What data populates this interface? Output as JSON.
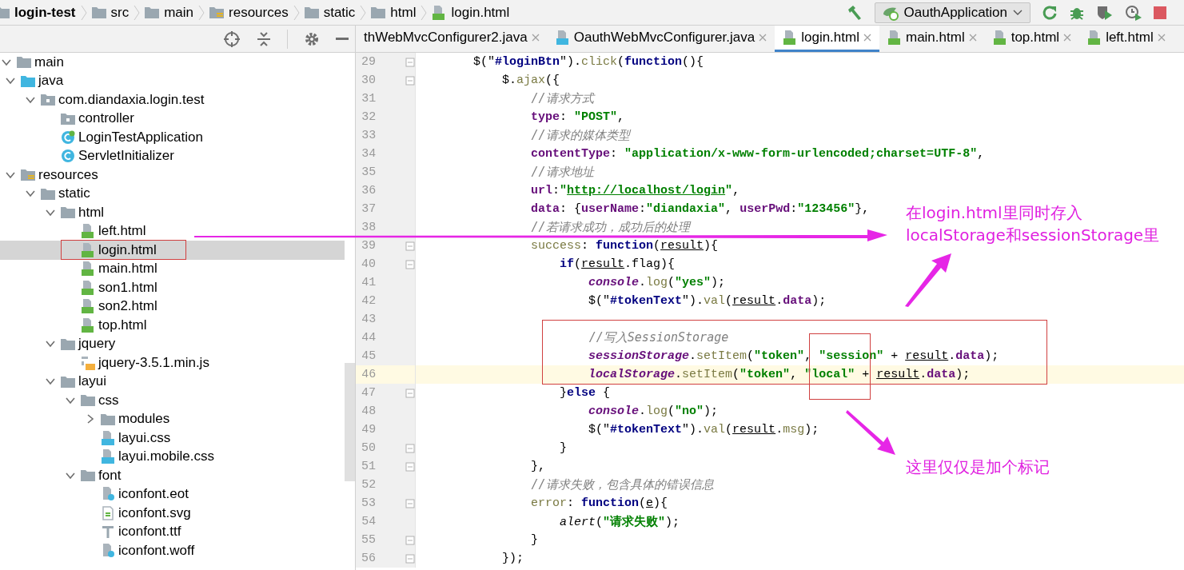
{
  "breadcrumbs": [
    {
      "label": "login-test",
      "kind": "project"
    },
    {
      "label": "src",
      "kind": "folder"
    },
    {
      "label": "main",
      "kind": "folder"
    },
    {
      "label": "resources",
      "kind": "resources"
    },
    {
      "label": "static",
      "kind": "folder"
    },
    {
      "label": "html",
      "kind": "folder"
    },
    {
      "label": "login.html",
      "kind": "html"
    }
  ],
  "run_config": {
    "label": "OauthApplication"
  },
  "tree": [
    {
      "label": "main",
      "kind": "folder",
      "expanded": true,
      "selected": false,
      "children": [
        {
          "label": "java",
          "kind": "source",
          "expanded": true,
          "selected": false,
          "children": [
            {
              "label": "com.diandaxia.login.test",
              "kind": "package",
              "expanded": true,
              "selected": false,
              "children": [
                {
                  "label": "controller",
                  "kind": "package",
                  "selected": false
                },
                {
                  "label": "LoginTestApplication",
                  "kind": "spring-class",
                  "selected": false
                },
                {
                  "label": "ServletInitializer",
                  "kind": "class",
                  "selected": false
                }
              ]
            }
          ]
        },
        {
          "label": "resources",
          "kind": "resources",
          "expanded": true,
          "selected": false,
          "children": [
            {
              "label": "static",
              "kind": "folder",
              "expanded": true,
              "selected": false,
              "children": [
                {
                  "label": "html",
                  "kind": "folder",
                  "expanded": true,
                  "selected": false,
                  "children": [
                    {
                      "label": "left.html",
                      "kind": "html",
                      "selected": false
                    },
                    {
                      "label": "login.html",
                      "kind": "html",
                      "selected": true
                    },
                    {
                      "label": "main.html",
                      "kind": "html",
                      "selected": false
                    },
                    {
                      "label": "son1.html",
                      "kind": "html",
                      "selected": false
                    },
                    {
                      "label": "son2.html",
                      "kind": "html",
                      "selected": false
                    },
                    {
                      "label": "top.html",
                      "kind": "html",
                      "selected": false
                    }
                  ]
                },
                {
                  "label": "jquery",
                  "kind": "folder",
                  "expanded": true,
                  "selected": false,
                  "children": [
                    {
                      "label": "jquery-3.5.1.min.js",
                      "kind": "js",
                      "selected": false
                    }
                  ]
                },
                {
                  "label": "layui",
                  "kind": "folder",
                  "expanded": true,
                  "selected": false,
                  "children": [
                    {
                      "label": "css",
                      "kind": "folder",
                      "expanded": true,
                      "selected": false,
                      "children": [
                        {
                          "label": "modules",
                          "kind": "folder",
                          "expanded": false,
                          "selected": false
                        },
                        {
                          "label": "layui.css",
                          "kind": "css",
                          "selected": false
                        },
                        {
                          "label": "layui.mobile.css",
                          "kind": "css",
                          "selected": false
                        }
                      ]
                    },
                    {
                      "label": "font",
                      "kind": "folder",
                      "expanded": true,
                      "selected": false,
                      "children": [
                        {
                          "label": "iconfont.eot",
                          "kind": "unknown",
                          "selected": false
                        },
                        {
                          "label": "iconfont.svg",
                          "kind": "svg",
                          "selected": false
                        },
                        {
                          "label": "iconfont.ttf",
                          "kind": "font",
                          "selected": false
                        },
                        {
                          "label": "iconfont.woff",
                          "kind": "unknown",
                          "selected": false
                        }
                      ]
                    }
                  ]
                }
              ]
            }
          ]
        }
      ]
    }
  ],
  "tabs": [
    {
      "label": "thWebMvcConfigurer2.java",
      "kind": "cut",
      "selected": false
    },
    {
      "label": "OauthWebMvcConfigurer.java",
      "kind": "java",
      "selected": false
    },
    {
      "label": "login.html",
      "kind": "html",
      "selected": true
    },
    {
      "label": "main.html",
      "kind": "html",
      "selected": false
    },
    {
      "label": "top.html",
      "kind": "html",
      "selected": false
    },
    {
      "label": "left.html",
      "kind": "html",
      "selected": false
    }
  ],
  "code": [
    {
      "number": "29",
      "fold": true,
      "current": false,
      "tokens": [
        {
          "kind": "p",
          "text": "        $(\""
        },
        {
          "kind": "sel",
          "text": "#loginBtn"
        },
        {
          "kind": "p",
          "text": "\")."
        },
        {
          "kind": "m",
          "text": "click"
        },
        {
          "kind": "p",
          "text": "("
        },
        {
          "kind": "kw",
          "text": "function"
        },
        {
          "kind": "p",
          "text": "(){"
        }
      ]
    },
    {
      "number": "30",
      "fold": true,
      "current": false,
      "tokens": [
        {
          "kind": "p",
          "text": "            $."
        },
        {
          "kind": "m",
          "text": "ajax"
        },
        {
          "kind": "p",
          "text": "({"
        }
      ]
    },
    {
      "number": "31",
      "fold": false,
      "current": false,
      "tokens": [
        {
          "kind": "c",
          "text": "                //请求方式"
        }
      ]
    },
    {
      "number": "32",
      "fold": false,
      "current": false,
      "tokens": [
        {
          "kind": "prop",
          "text": "                type"
        },
        {
          "kind": "p",
          "text": ": "
        },
        {
          "kind": "s",
          "text": "\"POST\""
        },
        {
          "kind": "p",
          "text": ","
        }
      ]
    },
    {
      "number": "33",
      "fold": false,
      "current": false,
      "tokens": [
        {
          "kind": "c",
          "text": "                //请求的媒体类型"
        }
      ]
    },
    {
      "number": "34",
      "fold": false,
      "current": false,
      "tokens": [
        {
          "kind": "prop",
          "text": "                contentType"
        },
        {
          "kind": "p",
          "text": ": "
        },
        {
          "kind": "s",
          "text": "\"application/x-www-form-urlencoded;charset=UTF-8\""
        },
        {
          "kind": "p",
          "text": ","
        }
      ]
    },
    {
      "number": "35",
      "fold": false,
      "current": false,
      "tokens": [
        {
          "kind": "c",
          "text": "                //请求地址"
        }
      ]
    },
    {
      "number": "36",
      "fold": false,
      "current": false,
      "tokens": [
        {
          "kind": "prop",
          "text": "                url"
        },
        {
          "kind": "p",
          "text": ":"
        },
        {
          "kind": "s",
          "text": "\""
        },
        {
          "kind": "link",
          "text": "http://localhost/login"
        },
        {
          "kind": "s",
          "text": "\""
        },
        {
          "kind": "p",
          "text": ","
        }
      ]
    },
    {
      "number": "37",
      "fold": false,
      "current": false,
      "tokens": [
        {
          "kind": "prop",
          "text": "                data"
        },
        {
          "kind": "p",
          "text": ": {"
        },
        {
          "kind": "prop",
          "text": "userName"
        },
        {
          "kind": "p",
          "text": ":"
        },
        {
          "kind": "s",
          "text": "\"diandaxia\""
        },
        {
          "kind": "p",
          "text": ", "
        },
        {
          "kind": "prop",
          "text": "userPwd"
        },
        {
          "kind": "p",
          "text": ":"
        },
        {
          "kind": "s",
          "text": "\"123456\""
        },
        {
          "kind": "p",
          "text": "},"
        }
      ]
    },
    {
      "number": "38",
      "fold": false,
      "current": false,
      "tokens": [
        {
          "kind": "c",
          "text": "                //若请求成功，成功后的处理"
        }
      ]
    },
    {
      "number": "39",
      "fold": true,
      "current": false,
      "tokens": [
        {
          "kind": "m",
          "text": "                success"
        },
        {
          "kind": "p",
          "text": ": "
        },
        {
          "kind": "kw",
          "text": "function"
        },
        {
          "kind": "p",
          "text": "("
        },
        {
          "kind": "u",
          "text": "result"
        },
        {
          "kind": "p",
          "text": "){"
        }
      ]
    },
    {
      "number": "40",
      "fold": true,
      "current": false,
      "tokens": [
        {
          "kind": "kw",
          "text": "                    if"
        },
        {
          "kind": "p",
          "text": "("
        },
        {
          "kind": "u",
          "text": "result"
        },
        {
          "kind": "p",
          "text": ".flag){"
        }
      ]
    },
    {
      "number": "41",
      "fold": false,
      "current": false,
      "tokens": [
        {
          "kind": "g",
          "text": "                        console"
        },
        {
          "kind": "p",
          "text": "."
        },
        {
          "kind": "m",
          "text": "log"
        },
        {
          "kind": "p",
          "text": "("
        },
        {
          "kind": "s",
          "text": "\"yes\""
        },
        {
          "kind": "p",
          "text": ");"
        }
      ]
    },
    {
      "number": "42",
      "fold": false,
      "current": false,
      "tokens": [
        {
          "kind": "p",
          "text": "                        $(\""
        },
        {
          "kind": "sel",
          "text": "#tokenText"
        },
        {
          "kind": "p",
          "text": "\")."
        },
        {
          "kind": "m",
          "text": "val"
        },
        {
          "kind": "p",
          "text": "("
        },
        {
          "kind": "u",
          "text": "result"
        },
        {
          "kind": "p",
          "text": "."
        },
        {
          "kind": "prop",
          "text": "data"
        },
        {
          "kind": "p",
          "text": ");"
        }
      ]
    },
    {
      "number": "43",
      "fold": false,
      "current": false
    },
    {
      "number": "44",
      "fold": false,
      "current": false,
      "tokens": [
        {
          "kind": "c",
          "text": "                        //写入SessionStorage"
        }
      ]
    },
    {
      "number": "45",
      "fold": false,
      "current": false,
      "tokens": [
        {
          "kind": "g",
          "text": "                        sessionStorage"
        },
        {
          "kind": "p",
          "text": "."
        },
        {
          "kind": "m",
          "text": "setItem"
        },
        {
          "kind": "p",
          "text": "("
        },
        {
          "kind": "s",
          "text": "\"token\""
        },
        {
          "kind": "p",
          "text": ", "
        },
        {
          "kind": "s",
          "text": "\"session\""
        },
        {
          "kind": "p",
          "text": " + "
        },
        {
          "kind": "u",
          "text": "result"
        },
        {
          "kind": "p",
          "text": "."
        },
        {
          "kind": "prop",
          "text": "data"
        },
        {
          "kind": "p",
          "text": ");"
        }
      ]
    },
    {
      "number": "46",
      "fold": false,
      "current": true,
      "tokens": [
        {
          "kind": "g",
          "text": "                        localStorage"
        },
        {
          "kind": "p",
          "text": "."
        },
        {
          "kind": "m",
          "text": "setItem"
        },
        {
          "kind": "p",
          "text": "("
        },
        {
          "kind": "s",
          "text": "\"token\""
        },
        {
          "kind": "p",
          "text": ", "
        },
        {
          "kind": "s",
          "text": "\"local\""
        },
        {
          "kind": "p",
          "text": " + "
        },
        {
          "kind": "u",
          "text": "result"
        },
        {
          "kind": "p",
          "text": "."
        },
        {
          "kind": "prop",
          "text": "data"
        },
        {
          "kind": "p",
          "text": ");"
        }
      ]
    },
    {
      "number": "47",
      "fold": true,
      "current": false,
      "tokens": [
        {
          "kind": "p",
          "text": "                    }"
        },
        {
          "kind": "kw",
          "text": "else"
        },
        {
          "kind": "p",
          "text": " {"
        }
      ]
    },
    {
      "number": "48",
      "fold": false,
      "current": false,
      "tokens": [
        {
          "kind": "g",
          "text": "                        console"
        },
        {
          "kind": "p",
          "text": "."
        },
        {
          "kind": "m",
          "text": "log"
        },
        {
          "kind": "p",
          "text": "("
        },
        {
          "kind": "s",
          "text": "\"no\""
        },
        {
          "kind": "p",
          "text": ");"
        }
      ]
    },
    {
      "number": "49",
      "fold": false,
      "current": false,
      "tokens": [
        {
          "kind": "p",
          "text": "                        $(\""
        },
        {
          "kind": "sel",
          "text": "#tokenText"
        },
        {
          "kind": "p",
          "text": "\")."
        },
        {
          "kind": "m",
          "text": "val"
        },
        {
          "kind": "p",
          "text": "("
        },
        {
          "kind": "u",
          "text": "result"
        },
        {
          "kind": "p",
          "text": "."
        },
        {
          "kind": "m",
          "text": "msg"
        },
        {
          "kind": "p",
          "text": ");"
        }
      ]
    },
    {
      "number": "50",
      "fold": true,
      "current": false,
      "tokens": [
        {
          "kind": "p",
          "text": "                    }"
        }
      ]
    },
    {
      "number": "51",
      "fold": true,
      "current": false,
      "tokens": [
        {
          "kind": "p",
          "text": "                },"
        }
      ]
    },
    {
      "number": "52",
      "fold": false,
      "current": false,
      "tokens": [
        {
          "kind": "c",
          "text": "                //请求失败，包含具体的错误信息"
        }
      ]
    },
    {
      "number": "53",
      "fold": true,
      "current": false,
      "tokens": [
        {
          "kind": "m",
          "text": "                error"
        },
        {
          "kind": "p",
          "text": ": "
        },
        {
          "kind": "kw",
          "text": "function"
        },
        {
          "kind": "p",
          "text": "("
        },
        {
          "kind": "u",
          "text": "e"
        },
        {
          "kind": "p",
          "text": "){"
        }
      ]
    },
    {
      "number": "54",
      "fold": false,
      "current": false,
      "tokens": [
        {
          "kind": "fn",
          "text": "                    alert"
        },
        {
          "kind": "p",
          "text": "("
        },
        {
          "kind": "s",
          "text": "\"请求失败\""
        },
        {
          "kind": "p",
          "text": ");"
        }
      ]
    },
    {
      "number": "55",
      "fold": true,
      "current": false,
      "tokens": [
        {
          "kind": "p",
          "text": "                }"
        }
      ]
    },
    {
      "number": "56",
      "fold": true,
      "current": false,
      "tokens": [
        {
          "kind": "p",
          "text": "            });"
        }
      ]
    }
  ],
  "notes": [
    {
      "lines": [
        "在login.html里同时存入",
        "localStorage和sessionStorage里"
      ]
    },
    {
      "lines": [
        "这里仅仅是加个标记"
      ]
    }
  ]
}
